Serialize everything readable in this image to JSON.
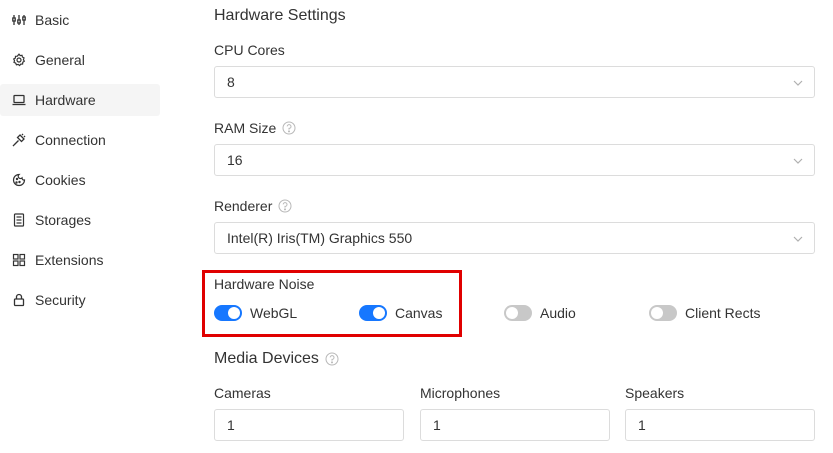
{
  "sidebar": {
    "items": [
      {
        "label": "Basic",
        "icon": "sliders-icon",
        "active": false
      },
      {
        "label": "General",
        "icon": "gear-icon",
        "active": false
      },
      {
        "label": "Hardware",
        "icon": "laptop-icon",
        "active": true
      },
      {
        "label": "Connection",
        "icon": "plug-icon",
        "active": false
      },
      {
        "label": "Cookies",
        "icon": "cookie-icon",
        "active": false
      },
      {
        "label": "Storages",
        "icon": "storage-icon",
        "active": false
      },
      {
        "label": "Extensions",
        "icon": "grid-icon",
        "active": false
      },
      {
        "label": "Security",
        "icon": "lock-icon",
        "active": false
      }
    ]
  },
  "hardware": {
    "title": "Hardware Settings",
    "cpu": {
      "label": "CPU Cores",
      "value": "8"
    },
    "ram": {
      "label": "RAM Size",
      "value": "16"
    },
    "renderer": {
      "label": "Renderer",
      "value": "Intel(R) Iris(TM) Graphics 550"
    }
  },
  "noise": {
    "label": "Hardware Noise",
    "toggles": [
      {
        "label": "WebGL",
        "on": true
      },
      {
        "label": "Canvas",
        "on": true
      },
      {
        "label": "Audio",
        "on": false
      },
      {
        "label": "Client Rects",
        "on": false
      }
    ]
  },
  "media": {
    "title": "Media Devices",
    "cameras": {
      "label": "Cameras",
      "value": "1"
    },
    "microphones": {
      "label": "Microphones",
      "value": "1"
    },
    "speakers": {
      "label": "Speakers",
      "value": "1"
    }
  },
  "colors": {
    "accent": "#1677ff",
    "highlight": "#e00000",
    "switch_off": "#c8c8c8"
  }
}
